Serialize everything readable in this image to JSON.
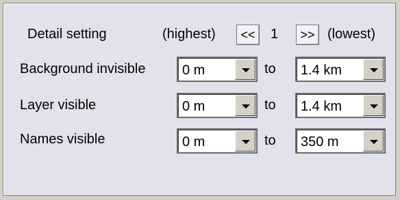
{
  "detail": {
    "label": "Detail setting",
    "highest_label": "(highest)",
    "prev_button": "<<",
    "level": "1",
    "next_button": ">>",
    "lowest_label": "(lowest)"
  },
  "rows": [
    {
      "label": "Background invisible",
      "from": "0 m",
      "to_label": "to",
      "to": "1.4 km"
    },
    {
      "label": "Layer visible",
      "from": "0 m",
      "to_label": "to",
      "to": "1.4 km"
    },
    {
      "label": "Names visible",
      "from": "0 m",
      "to_label": "to",
      "to": "350 m"
    }
  ],
  "icons": {
    "dropdown": "chevron-down-icon"
  }
}
